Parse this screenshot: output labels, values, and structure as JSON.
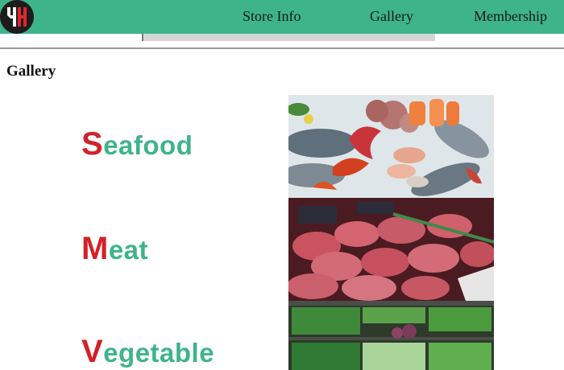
{
  "nav": {
    "logo_icon": "yh-logo-icon",
    "links": [
      "Store Info",
      "Gallery",
      "Membership"
    ],
    "background": "#3eb489"
  },
  "gallery": {
    "heading": "Gallery",
    "categories": [
      {
        "initial": "S",
        "rest": "eafood",
        "image": "seafood-photo"
      },
      {
        "initial": "M",
        "rest": "eat",
        "image": "meat-photo"
      },
      {
        "initial": "V",
        "rest": "egetable",
        "image": "vegetable-photo"
      }
    ],
    "initial_color": "#d4202a",
    "text_color": "#3eb489"
  }
}
